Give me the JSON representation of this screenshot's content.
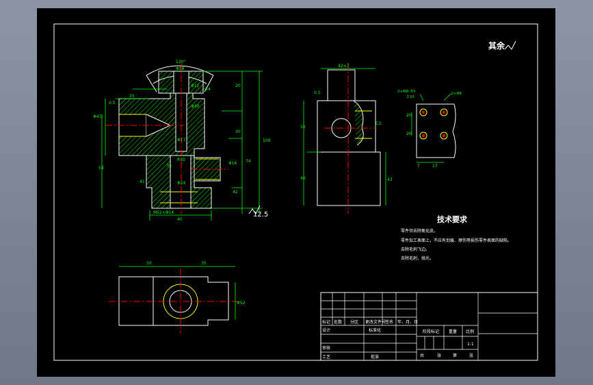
{
  "colors": {
    "background": "#000000",
    "border": "#ffffff",
    "dimension": "#00ff00",
    "outline": "#ffffff",
    "hatch": "#00ff00",
    "center_line": "#ff0000",
    "thread": "#ffff00",
    "text": "#ffffff"
  },
  "labels": {
    "roughness_note": "其余",
    "roughness_symbol": "12.5"
  },
  "front_view": {
    "angle": "120°",
    "dia_top": "Φ18",
    "dia_bore_top": "Φ12",
    "dim_top": "20",
    "dim_left_top": "25",
    "chamfer": "0.5",
    "label_a": "Φ4",
    "dia_left": "Φ43",
    "dim_c": "Φ30",
    "mid_dim": "30",
    "dim_b": "Φ17",
    "dim_r": "R30",
    "dim_l": "54",
    "dim_left_mid": "41",
    "label_rp": "P1",
    "dia_small": "Φ16",
    "dia_mid": "Φ24",
    "dim_height": "100",
    "dim_right_mid": "74",
    "dim_right_low": "42",
    "thread": "M52×Φ14",
    "dim_bottom": "40"
  },
  "side_view": {
    "top_dim": "42±7",
    "chamfer": "0.5",
    "dim_left": "52",
    "dim_bottom": "40",
    "dim_right": "43",
    "label_r": "C3"
  },
  "detail_view": {
    "label_a": "2×M8-7H",
    "label_b": "↧10",
    "label_c": "2×Φ8",
    "dim_v1": "20",
    "dim_v2": "20",
    "dim_h1": "7",
    "dim_h2": "17"
  },
  "top_view": {
    "dim_left": "50",
    "dim_right": "35",
    "dia": "Φ52"
  },
  "tech_req": {
    "title": "技术要求",
    "items": [
      "零件须去除氧化皮。",
      "零件加工表面上，不应有划痕、擦伤等损伤零件表面的缺陷。",
      "去除毛刺飞边。",
      "去除毛刺，抛光。"
    ]
  },
  "title_block": {
    "row_labels": [
      "标记",
      "处数",
      "分区",
      "更改文件号",
      "签名",
      "年、月、日"
    ],
    "design": "设计",
    "standard": "标准化",
    "review": "审核",
    "craft": "工艺",
    "approve": "批准",
    "stage": "阶段标记",
    "weight": "重量",
    "scale": "比例",
    "scale_value": "1:1",
    "sheet_total": "共",
    "sheet_unit": "张",
    "sheet_no": "第",
    "sheet_unit2": "张"
  }
}
